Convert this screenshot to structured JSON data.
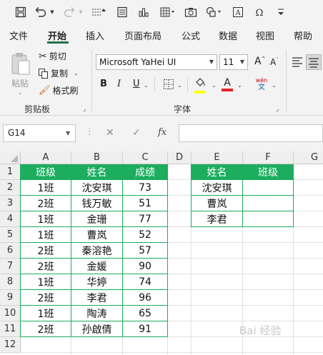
{
  "quick_access": {
    "icons": [
      "save-icon",
      "undo-icon",
      "redo-icon",
      "sort-icon",
      "form-icon",
      "chart-icon",
      "table-icon",
      "camera-icon",
      "shapes-icon",
      "textbox-icon",
      "symbol-icon",
      "more-icon"
    ]
  },
  "ribbon_tabs": [
    "文件",
    "开始",
    "插入",
    "页面布局",
    "公式",
    "数据",
    "视图",
    "帮助"
  ],
  "active_tab": "开始",
  "clipboard": {
    "paste_label": "粘贴",
    "cut_label": "剪切",
    "copy_label": "复制",
    "format_painter_label": "格式刷",
    "group_label": "剪贴板"
  },
  "font": {
    "family": "Microsoft YaHei UI",
    "size": "11",
    "group_label": "字体",
    "phonetic_label": "wén",
    "phonetic_sub": "文",
    "bold": "B",
    "italic": "I",
    "underline": "U",
    "font_color_letter": "A"
  },
  "formula_bar": {
    "name_box": "G14",
    "fx_label": "fx",
    "cancel_glyph": "✕",
    "enter_glyph": "✓",
    "value": ""
  },
  "sheet": {
    "columns": [
      "A",
      "B",
      "C",
      "D",
      "E",
      "F",
      "G"
    ],
    "rows": [
      "1",
      "2",
      "3",
      "4",
      "5",
      "6",
      "7",
      "8",
      "9",
      "10",
      "11",
      "12"
    ],
    "table1": {
      "headers": [
        "班级",
        "姓名",
        "成绩"
      ],
      "rows": [
        [
          "1班",
          "沈安琪",
          "73"
        ],
        [
          "2班",
          "钱万敏",
          "51"
        ],
        [
          "1班",
          "金珊",
          "77"
        ],
        [
          "1班",
          "曹岚",
          "52"
        ],
        [
          "2班",
          "秦溶艳",
          "57"
        ],
        [
          "2班",
          "金媛",
          "90"
        ],
        [
          "1班",
          "华婷",
          "74"
        ],
        [
          "2班",
          "李君",
          "96"
        ],
        [
          "1班",
          "陶涛",
          "65"
        ],
        [
          "2班",
          "孙啟倩",
          "91"
        ]
      ]
    },
    "table2": {
      "headers": [
        "姓名",
        "班级"
      ],
      "rows": [
        [
          "沈安琪",
          ""
        ],
        [
          "曹岚",
          ""
        ],
        [
          "李君",
          ""
        ]
      ]
    }
  },
  "colors": {
    "header_green": "#1cad5f",
    "accent": "#217346"
  },
  "watermark": "Bai 经验"
}
